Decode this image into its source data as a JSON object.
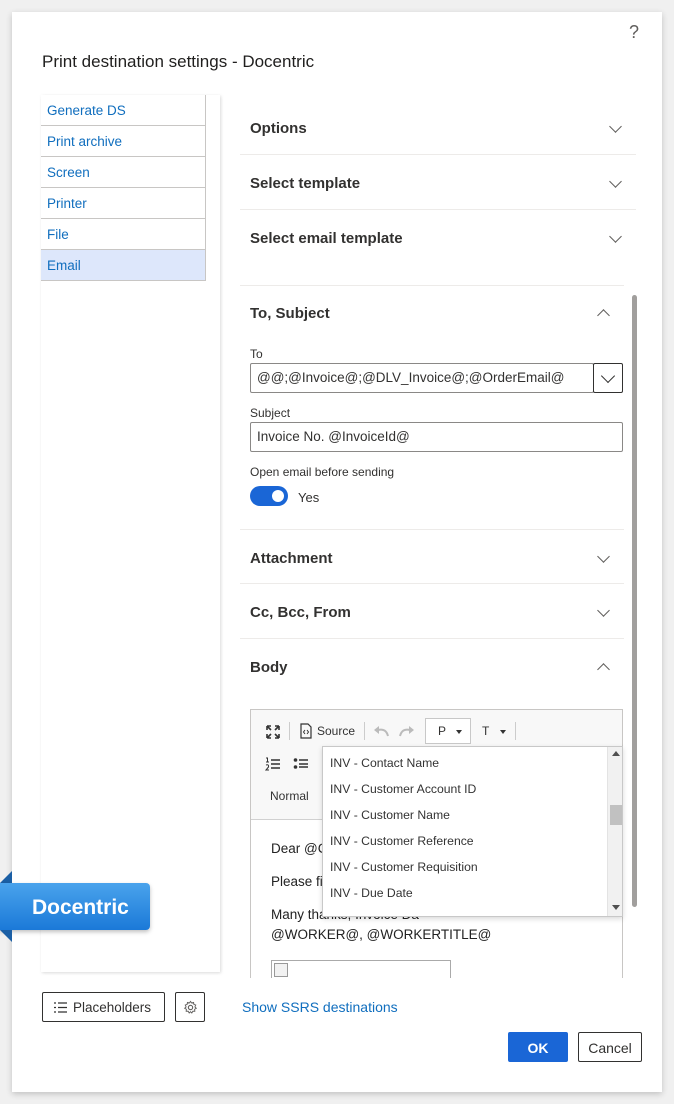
{
  "dialog": {
    "title": "Print destination settings - Docentric",
    "help": "?"
  },
  "nav": {
    "items": [
      {
        "label": "Generate DS"
      },
      {
        "label": "Print archive"
      },
      {
        "label": "Screen"
      },
      {
        "label": "Printer"
      },
      {
        "label": "File"
      },
      {
        "label": "Email"
      }
    ]
  },
  "sections": {
    "options": "Options",
    "select_template": "Select template",
    "select_email_template": "Select email template",
    "to_subject": "To, Subject",
    "attachment": "Attachment",
    "cc_bcc_from": "Cc, Bcc, From",
    "body": "Body"
  },
  "fields": {
    "to_label": "To",
    "to_value": "@@;@Invoice@;@DLV_Invoice@;@OrderEmail@",
    "subject_label": "Subject",
    "subject_value": "Invoice No. @InvoiceId@",
    "open_email_label": "Open email before sending",
    "open_email_value": "Yes"
  },
  "editor": {
    "toolbar": {
      "source": "Source",
      "format": "P",
      "font": "T",
      "style": "Normal"
    },
    "body_lines": [
      "Dear @C",
      "Please fi",
      "Many thanks,",
      "@WORKER@, @WORKERTITLE@"
    ],
    "hidden_fragment": "Invoice Da"
  },
  "placeholder_dropdown": {
    "items": [
      "INV - Contact Name",
      "INV - Customer Account ID",
      "INV - Customer Name",
      "INV - Customer Reference",
      "INV - Customer Requisition",
      "INV - Due Date"
    ]
  },
  "footer": {
    "placeholders": "Placeholders",
    "show_ssrs": "Show SSRS destinations",
    "ok": "OK",
    "cancel": "Cancel"
  },
  "badge": "Docentric",
  "colors": {
    "accent": "#1a66d6",
    "link": "#106ebe",
    "nav_active": "#dde7fb"
  }
}
